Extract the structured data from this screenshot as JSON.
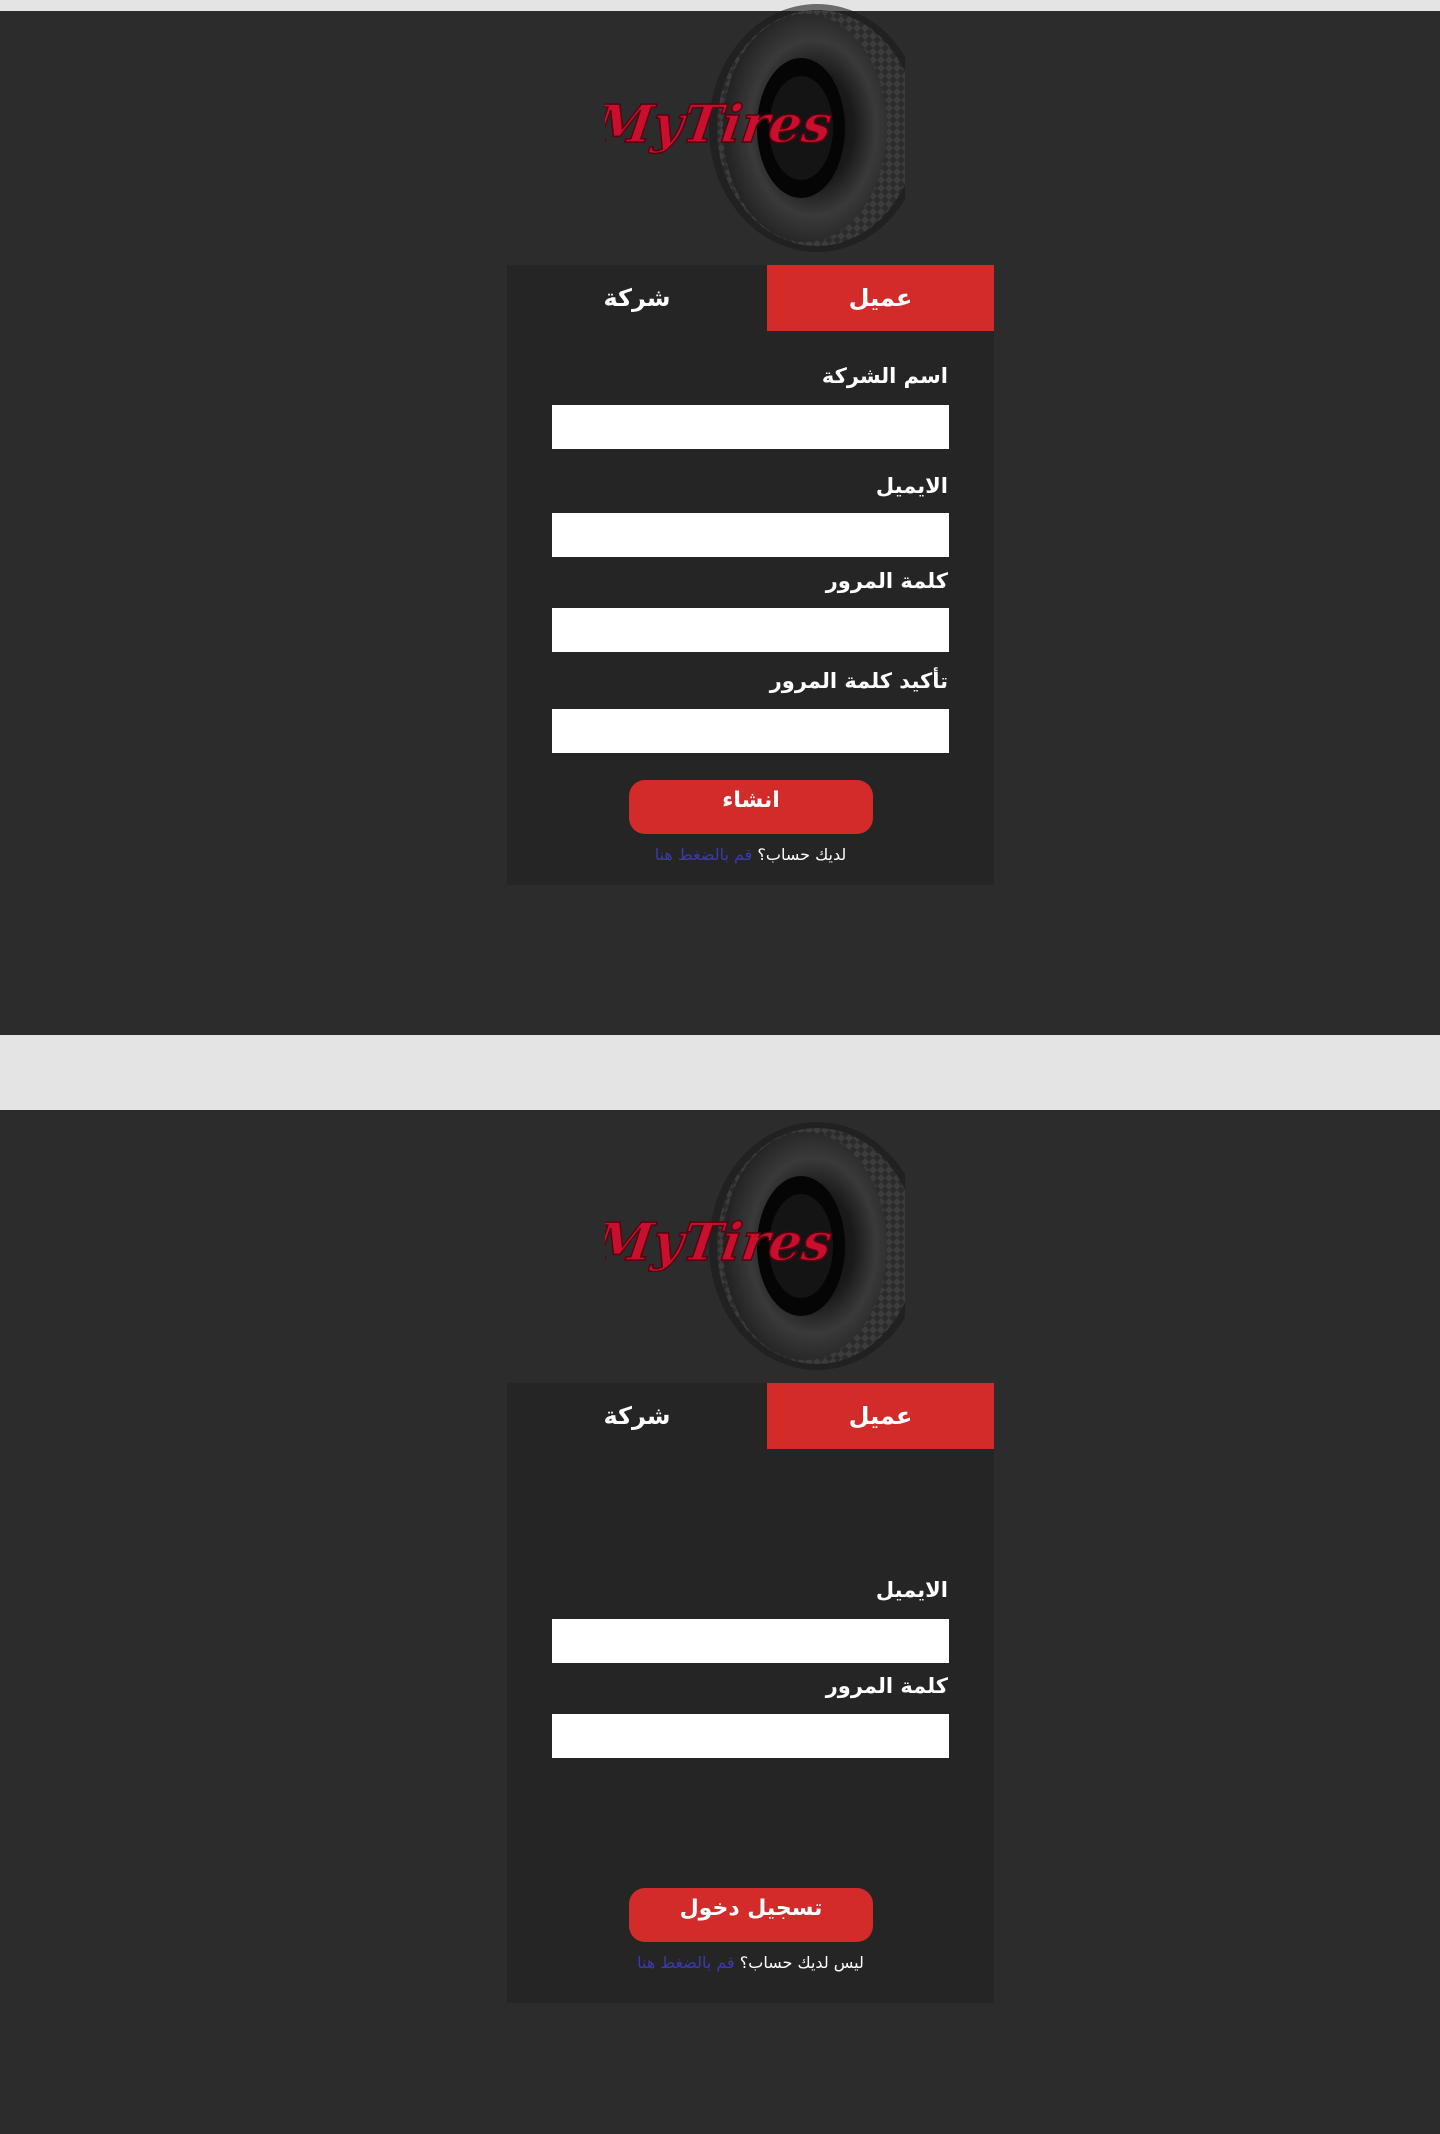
{
  "brand": {
    "logo_text": "MyTires",
    "accent_color": "#d32a2a",
    "link_color": "#3a3ab0"
  },
  "register_view": {
    "tabs": {
      "customer": "عميل",
      "company": "شركة"
    },
    "fields": {
      "company_name_label": "اسم الشركة",
      "email_label": "الايميل",
      "password_label": "كلمة المرور",
      "confirm_password_label": "تأكيد كلمة المرور"
    },
    "submit_label": "انشاء",
    "footer": {
      "prompt": "لديك حساب؟",
      "link": "قم بالضغط هنا"
    }
  },
  "login_view": {
    "tabs": {
      "customer": "عميل",
      "company": "شركة"
    },
    "fields": {
      "email_label": "الايميل",
      "password_label": "كلمة المرور"
    },
    "submit_label": "تسجيل دخول",
    "footer": {
      "prompt": "ليس لديك حساب؟",
      "link": "قم بالضغط هنا"
    }
  }
}
